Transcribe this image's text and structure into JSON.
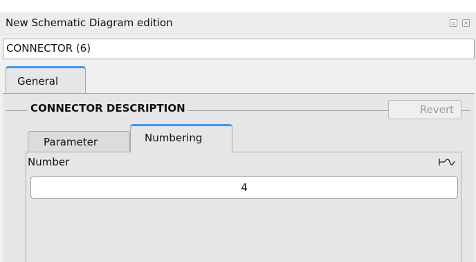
{
  "window": {
    "title": "New Schematic Diagram edition",
    "float_icon": "float-icon",
    "close_icon": "close-icon"
  },
  "object_name": {
    "value": "CONNECTOR (6)"
  },
  "tabs": [
    {
      "label": "General",
      "active": true
    }
  ],
  "group": {
    "title": "CONNECTOR DESCRIPTION",
    "revert_label": "Revert",
    "revert_enabled": false
  },
  "subtabs": [
    {
      "label": "Parameter",
      "active": false
    },
    {
      "label": "Numbering",
      "active": true
    }
  ],
  "numbering": {
    "field_label": "Number",
    "field_icon": "formula-icon",
    "value": "4"
  },
  "colors": {
    "accent": "#3399ff",
    "panel": "#e6e6e6",
    "disabled_text": "#9a9a9a"
  }
}
